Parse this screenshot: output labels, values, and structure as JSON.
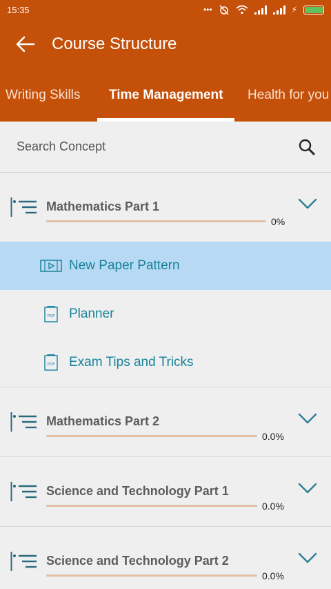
{
  "status": {
    "time": "15:35"
  },
  "header": {
    "title": "Course Structure"
  },
  "tabs": [
    {
      "label": "Writing Skills",
      "active": false
    },
    {
      "label": "Time Management",
      "active": true
    },
    {
      "label": "Health for you",
      "active": false
    }
  ],
  "search": {
    "placeholder": "Search Concept"
  },
  "sections": [
    {
      "title": "Mathematics Part 1",
      "progress_label": "0%",
      "progress": 0,
      "expanded": true,
      "items": [
        {
          "label": "New Paper Pattern",
          "icon": "video-icon",
          "highlighted": true
        },
        {
          "label": "Planner",
          "icon": "pdf-icon",
          "highlighted": false
        },
        {
          "label": "Exam Tips and Tricks",
          "icon": "pdf-icon",
          "highlighted": false
        }
      ]
    },
    {
      "title": "Mathematics Part 2",
      "progress_label": "0.0%",
      "progress": 0,
      "expanded": false
    },
    {
      "title": "Science and Technology Part 1",
      "progress_label": "0.0%",
      "progress": 0,
      "expanded": false
    },
    {
      "title": "Science and Technology Part 2",
      "progress_label": "0.0%",
      "progress": 0,
      "expanded": false
    }
  ],
  "colors": {
    "primary": "#c4500a",
    "link": "#17839c",
    "highlight": "#b8d9f3",
    "progress_track": "#e3bfa5"
  }
}
